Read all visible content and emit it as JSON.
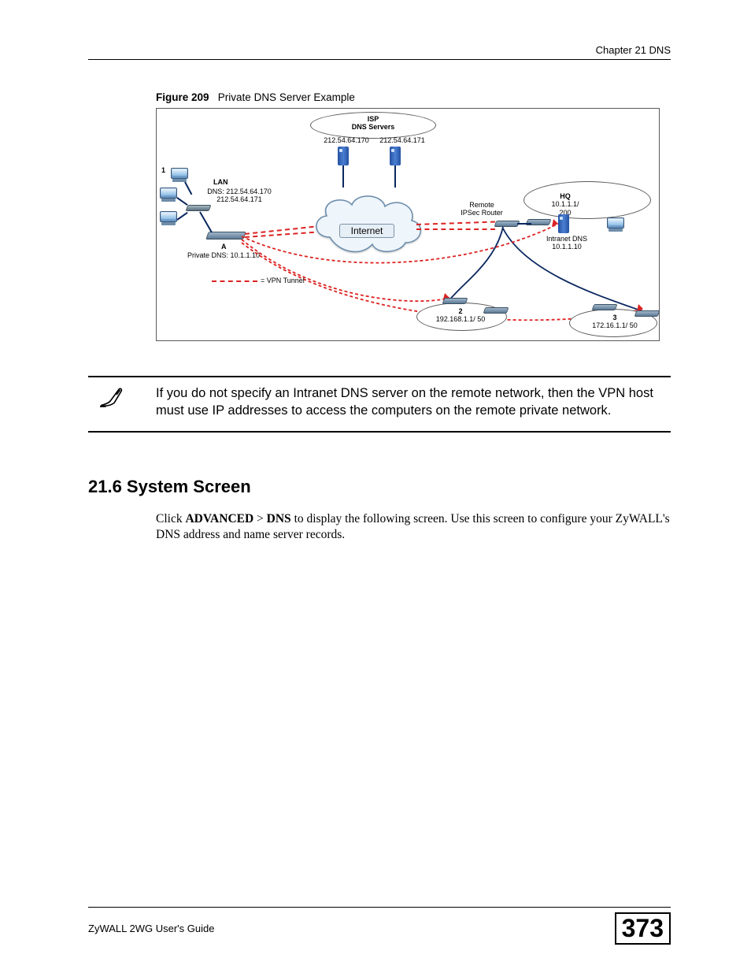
{
  "header": {
    "chapter": "Chapter 21 DNS"
  },
  "figure": {
    "label": "Figure 209",
    "title": "Private DNS Server Example",
    "isp": {
      "title1": "ISP",
      "title2": "DNS Servers",
      "ip1": "212.54.64.170",
      "ip2": "212.54.64.171"
    },
    "lan": {
      "title": "LAN",
      "dns1": "DNS: 212.54.64.170",
      "dns2": "212.54.64.171",
      "node1": "1",
      "a_label": "A",
      "a_privdns": "Private DNS: 10.1.1.10"
    },
    "internet": "Internet",
    "vpn_legend": "= VPN Tunnel",
    "remote": {
      "l1": "Remote",
      "l2": "IPSec Router"
    },
    "hq": {
      "title": "HQ",
      "subnet": "10.1.1.1/ 200",
      "intranet1": "Intranet DNS",
      "intranet2": "10.1.1.10"
    },
    "site2": {
      "n": "2",
      "ip": "192.168.1.1/ 50"
    },
    "site3": {
      "n": "3",
      "ip": "172.16.1.1/ 50"
    }
  },
  "note": {
    "text": "If you do not specify an Intranet DNS server on the remote network, then the VPN host must use IP addresses to access the computers on the remote private network."
  },
  "section": {
    "heading": "21.6  System Screen",
    "p_pre": "Click ",
    "adv": "ADVANCED",
    "gt": " > ",
    "dns": "DNS",
    "p_post": " to display the following screen. Use this screen to configure your ZyWALL's DNS address and name server records."
  },
  "footer": {
    "guide": "ZyWALL 2WG User's Guide",
    "page": "373"
  }
}
